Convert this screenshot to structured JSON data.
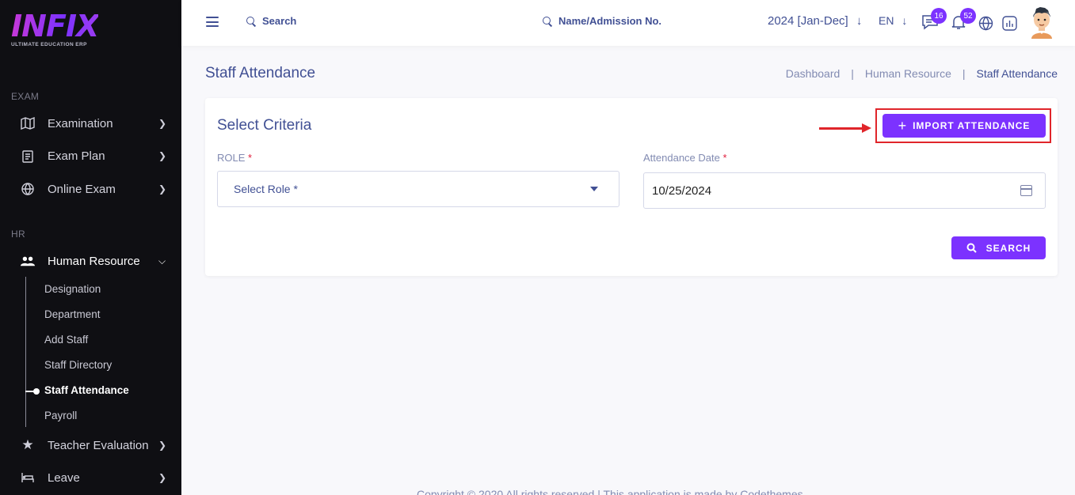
{
  "brand": {
    "name": "INFIX",
    "tagline": "ULTIMATE EDUCATION ERP"
  },
  "sidebar": {
    "sections": [
      {
        "label": "EXAM"
      },
      {
        "label": "HR"
      }
    ],
    "exam_items": [
      {
        "label": "Examination",
        "icon": "map-icon"
      },
      {
        "label": "Exam Plan",
        "icon": "clipboard-icon"
      },
      {
        "label": "Online Exam",
        "icon": "globe-icon"
      }
    ],
    "hr_item": {
      "label": "Human Resource",
      "icon": "users-icon"
    },
    "hr_subitems": [
      {
        "label": "Designation"
      },
      {
        "label": "Department"
      },
      {
        "label": "Add Staff"
      },
      {
        "label": "Staff Directory"
      },
      {
        "label": "Staff Attendance",
        "active": true
      },
      {
        "label": "Payroll"
      }
    ],
    "after_items": [
      {
        "label": "Teacher Evaluation",
        "icon": "star-icon"
      },
      {
        "label": "Leave",
        "icon": "bed-icon"
      }
    ]
  },
  "header": {
    "search_label": "Search",
    "student_search_label": "Name/Admission No.",
    "session": "2024 [Jan-Dec]",
    "language": "EN",
    "messages_count": "16",
    "notifications_count": "52"
  },
  "page": {
    "title": "Staff Attendance",
    "breadcrumb": [
      "Dashboard",
      "Human Resource",
      "Staff Attendance"
    ]
  },
  "criteria": {
    "title": "Select Criteria",
    "import_button": "IMPORT ATTENDANCE",
    "role_label": "ROLE",
    "role_placeholder": "Select Role *",
    "date_label": "Attendance Date",
    "date_value": "10/25/2024",
    "search_button": "SEARCH"
  },
  "footer": {
    "text": "Copyright © 2020 All rights reserved | This application is made by Codethemes"
  },
  "colors": {
    "accent": "#7c32ff",
    "sidebar_bg": "#0f0f13",
    "annotation": "#e0252a",
    "text": "#415094"
  }
}
